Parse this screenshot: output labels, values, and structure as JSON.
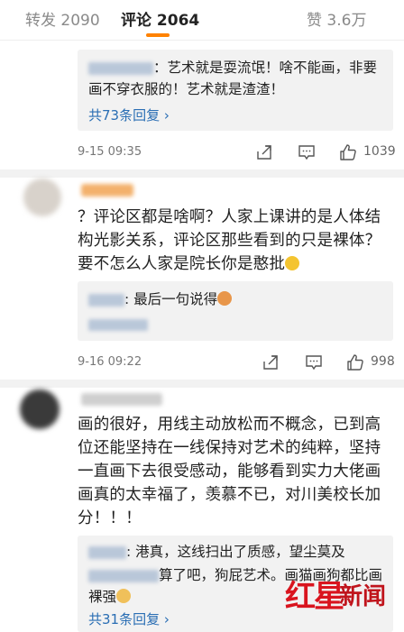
{
  "tabs": {
    "repost": "转发 2090",
    "comments": "评论 2064",
    "likes": "赞 3.6万"
  },
  "comment_a": {
    "reply_line1": "：艺术就是耍流氓！啥不能画，非要",
    "reply_line2": "画不穿衣服的！艺术就是渣渣！",
    "more_replies": "共73条回复 ›",
    "time": "9-15 09:35",
    "likes": "1039"
  },
  "comment_b": {
    "line1": "？评论区都是啥啊？人家上课讲的是人体结",
    "line2": "构光影关系，评论区那些看到的只是裸体？",
    "line3": "要不怎么人家是院长你是憨批",
    "reply_line1": ": 最后一句说得",
    "time": "9-16 09:22",
    "likes": "998"
  },
  "comment_c": {
    "line1": "画的很好，用线主动放松而不概念，已到高",
    "line2": "位还能坚持在一线保持对艺术的纯粹，坚持",
    "line3": "一直画下去很受感动，能够看到实力大佬画",
    "line4": "画真的太幸福了，羡慕不已，对川美校长加",
    "line5": "分！！！",
    "reply1_line": ": 港真，这线扫出了质感，望尘莫及",
    "reply2_line1": "算了吧，狗屁艺术。画猫画狗都比画",
    "reply2_line2": "裸强",
    "more_replies": "共31条回复 ›"
  },
  "watermark": {
    "part1": "红星",
    "part2": "新闻"
  },
  "colors": {
    "accent": "#ff8200",
    "link": "#2a6eb4",
    "watermark": "#d9141e"
  }
}
